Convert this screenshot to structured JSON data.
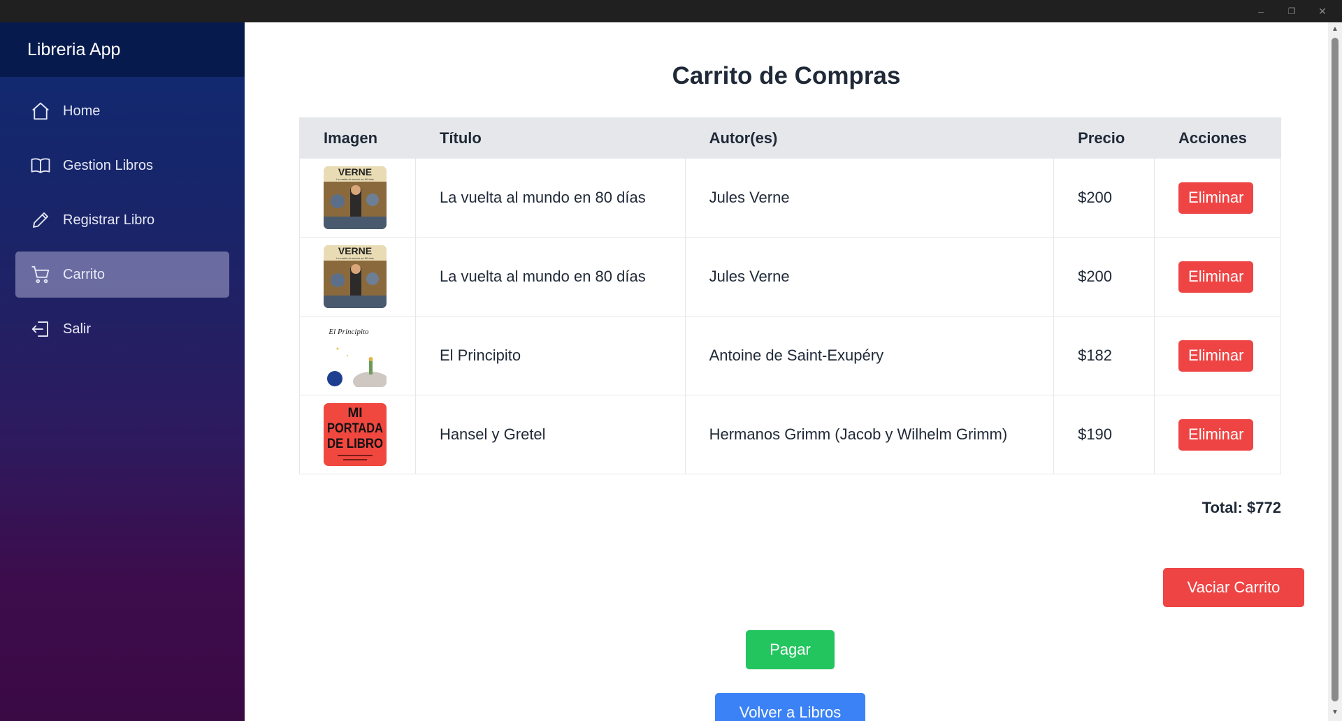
{
  "window": {
    "minimize": "–",
    "restore": "❐",
    "close": "✕"
  },
  "sidebar": {
    "brand": "Libreria App",
    "items": [
      {
        "label": "Home",
        "icon": "home-icon",
        "active": false
      },
      {
        "label": "Gestion Libros",
        "icon": "book-icon",
        "active": false
      },
      {
        "label": "Registrar Libro",
        "icon": "pencil-icon",
        "active": false
      },
      {
        "label": "Carrito",
        "icon": "cart-icon",
        "active": true
      },
      {
        "label": "Salir",
        "icon": "logout-icon",
        "active": false
      }
    ]
  },
  "main": {
    "title": "Carrito de Compras",
    "columns": [
      "Imagen",
      "Título",
      "Autor(es)",
      "Precio",
      "Acciones"
    ],
    "rows": [
      {
        "cover": "verne-cover",
        "title": "La vuelta al mundo en 80 días",
        "author": "Jules Verne",
        "price": "$200",
        "action": "Eliminar"
      },
      {
        "cover": "verne-cover",
        "title": "La vuelta al mundo en 80 días",
        "author": "Jules Verne",
        "price": "$200",
        "action": "Eliminar"
      },
      {
        "cover": "principito-cover",
        "title": "El Principito",
        "author": "Antoine de Saint-Exupéry",
        "price": "$182",
        "action": "Eliminar"
      },
      {
        "cover": "mi-portada-cover",
        "title": "Hansel y Gretel",
        "author": "Hermanos Grimm (Jacob y Wilhelm Grimm)",
        "price": "$190",
        "action": "Eliminar"
      }
    ],
    "cover_text": {
      "verne": "VERNE",
      "verne_sub": "La vuelta al mundo en 80 días",
      "principito": "El Principito",
      "portada_lines": [
        "MI",
        "PORTADA",
        "DE LIBRO"
      ]
    },
    "total_label": "Total: $772",
    "empty_button": "Vaciar Carrito",
    "pay_button": "Pagar",
    "back_button": "Volver a Libros"
  },
  "colors": {
    "danger": "#ef4444",
    "success": "#22c55e",
    "primary": "#3b82f6",
    "sidebar_top": "#071a4d",
    "sidebar_bottom": "#3a0a45"
  }
}
